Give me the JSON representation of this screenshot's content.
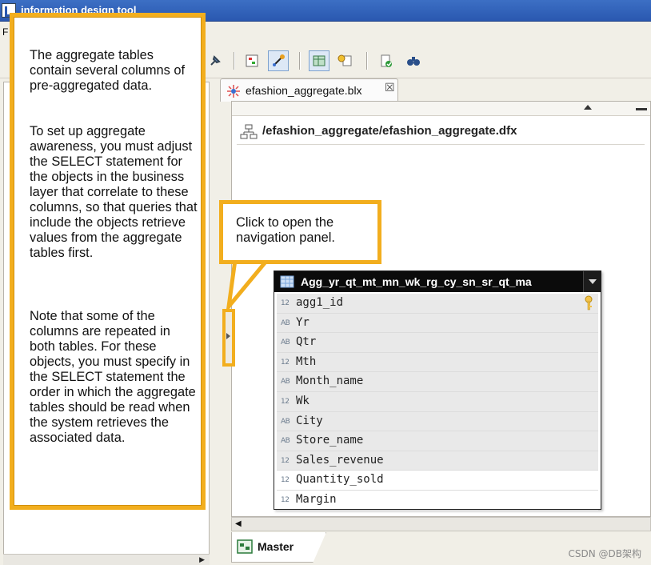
{
  "window": {
    "title": "information design tool",
    "menu_first": "F"
  },
  "editor": {
    "tab_label": "efashion_aggregate.blx",
    "close_glyph": "☒",
    "path": "/efashion_aggregate/efashion_aggregate.dfx",
    "bottom_tab": "Master"
  },
  "table": {
    "name": "Agg_yr_qt_mt_mn_wk_rg_cy_sn_sr_qt_ma",
    "columns": [
      {
        "type": "12",
        "name": "agg1_id",
        "key": true
      },
      {
        "type": "AB",
        "name": "Yr"
      },
      {
        "type": "AB",
        "name": "Qtr"
      },
      {
        "type": "12",
        "name": "Mth"
      },
      {
        "type": "AB",
        "name": "Month_name"
      },
      {
        "type": "12",
        "name": "Wk"
      },
      {
        "type": "AB",
        "name": "City"
      },
      {
        "type": "AB",
        "name": "Store_name"
      },
      {
        "type": "12",
        "name": "Sales_revenue"
      },
      {
        "type": "12",
        "name": "Quantity_sold"
      },
      {
        "type": "12",
        "name": "Margin"
      }
    ]
  },
  "callouts": {
    "left": {
      "p1": "The aggregate tables contain several columns of pre-aggregated data.",
      "p2": "To set up aggregate awareness, you must adjust the SELECT statement for the objects in the business layer that correlate to these columns, so that queries that include the objects retrieve values from the aggregate tables first.",
      "p3": "Note that some of the columns are repeated in both tables. For these objects, you must specify in the SELECT statement the order in which the aggregate tables should be read when the system retrieves the associated data."
    },
    "right": "Click to open the navigation panel."
  },
  "watermark": "CSDN @DB架构",
  "colors": {
    "callout_border": "#f2ae1e",
    "titlebar": "#2a58b0",
    "table_header": "#0b0b0b"
  }
}
